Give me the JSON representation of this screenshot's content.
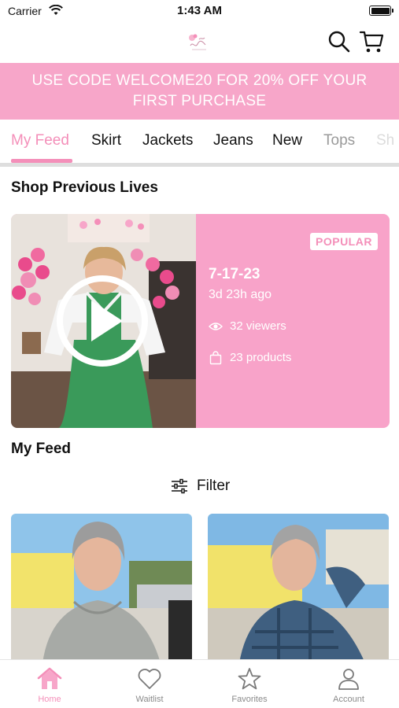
{
  "status_bar": {
    "carrier": "Carrier",
    "time": "1:43 AM"
  },
  "promo": {
    "text": "USE CODE WELCOME20 FOR 20% OFF YOUR FIRST PURCHASE"
  },
  "tabs": [
    {
      "label": "My Feed",
      "active": true
    },
    {
      "label": "Skirt"
    },
    {
      "label": "Jackets"
    },
    {
      "label": "Jeans"
    },
    {
      "label": "New"
    },
    {
      "label": "Tops"
    },
    {
      "label": "Sh"
    }
  ],
  "shop_previous_lives": {
    "title": "Shop Previous Lives",
    "live": {
      "badge": "POPULAR",
      "date": "7-17-23",
      "ago": "3d 23h ago",
      "viewers": "32 viewers",
      "products": "23 products"
    }
  },
  "my_feed": {
    "title": "My Feed",
    "filter_label": "Filter"
  },
  "bottom_nav": [
    {
      "label": "Home",
      "icon": "home-icon",
      "active": true
    },
    {
      "label": "Waitlist",
      "icon": "heart-icon"
    },
    {
      "label": "Favorites",
      "icon": "star-icon"
    },
    {
      "label": "Account",
      "icon": "user-icon"
    }
  ],
  "colors": {
    "accent": "#f48fb9",
    "banner": "#f7a6c9",
    "card": "#f8a3c9"
  }
}
